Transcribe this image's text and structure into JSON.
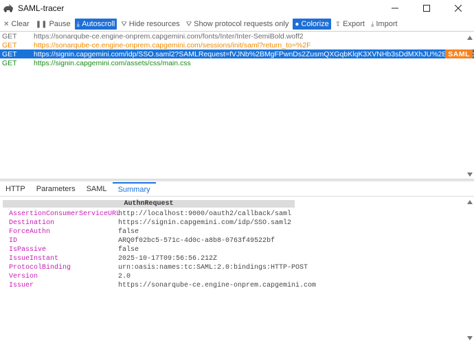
{
  "window": {
    "title": "SAML-tracer",
    "controls": [
      "minimize",
      "maximize",
      "close"
    ]
  },
  "toolbar": {
    "buttons": [
      {
        "label": "Clear",
        "icon": "close-icon",
        "glyph": "✕",
        "active": false
      },
      {
        "label": "Pause",
        "icon": "pause-icon",
        "glyph": "❚❚",
        "active": false
      },
      {
        "label": "Autoscroll",
        "icon": "download-icon",
        "glyph": "⤓",
        "active": true
      },
      {
        "label": "Hide resources",
        "icon": "filter-icon",
        "glyph": "⛛",
        "active": false
      },
      {
        "label": "Show protocol requests only",
        "icon": "filter-icon",
        "glyph": "⛛",
        "active": false
      },
      {
        "label": "Colorize",
        "icon": "palette-icon",
        "glyph": "●",
        "active": true
      },
      {
        "label": "Export",
        "icon": "export-icon",
        "glyph": "⇪",
        "active": false
      },
      {
        "label": "Import",
        "icon": "import-icon",
        "glyph": "⤓",
        "active": false
      }
    ]
  },
  "requests": [
    {
      "method": "GET",
      "url": "https://sonarqube-ce.engine-onprem.capgemini.com/fonts/Inter/Inter-SemiBold.woff2",
      "color": "gray",
      "selected": false,
      "badge": ""
    },
    {
      "method": "GET",
      "url": "https://sonarqube-ce.engine-onprem.capgemini.com/sessions/init/saml?return_to=%2F",
      "color": "orange",
      "selected": false,
      "badge": ""
    },
    {
      "method": "GET",
      "url": "https://signin.capgemini.com/idp/SSO.saml2?SAMLRequest=fVJNb%2BMgFPwnDs2ZusmQXGqbKlqK3XVNHb3sDdMXhJU%2B%2BHycLQ%",
      "color": "white",
      "selected": true,
      "badge": "SAML"
    },
    {
      "method": "GET",
      "url": "https://signin.capgemini.com/assets/css/main.css",
      "color": "green",
      "selected": false,
      "badge": ""
    }
  ],
  "tabs": [
    {
      "label": "HTTP",
      "active": false
    },
    {
      "label": "Parameters",
      "active": false
    },
    {
      "label": "SAML",
      "active": false
    },
    {
      "label": "Summary",
      "active": true
    }
  ],
  "summary": {
    "header": "AuthnRequest",
    "rows": [
      {
        "key": "AssertionConsumerServiceURL",
        "value": "http://localhost:9000/oauth2/callback/saml"
      },
      {
        "key": "Destination",
        "value": "https://signin.capgemini.com/idp/SSO.saml2"
      },
      {
        "key": "ForceAuthn",
        "value": "false"
      },
      {
        "key": "ID",
        "value": "ARQ0f02bc5-571c-4d0c-a8b8-0763f49522bf"
      },
      {
        "key": "IsPassive",
        "value": "false"
      },
      {
        "key": "IssueInstant",
        "value": "2025-10-17T09:56:56.212Z"
      },
      {
        "key": "ProtocolBinding",
        "value": "urn:oasis:names:tc:SAML:2.0:bindings:HTTP-POST"
      },
      {
        "key": "Version",
        "value": "2.0"
      },
      {
        "key": "Issuer",
        "value": "https://sonarqube-ce.engine-onprem.capgemini.com"
      }
    ]
  },
  "colors": {
    "accent": "#1a73d9",
    "saml_badge": "#f58220",
    "summary_key": "#c81bb4"
  }
}
